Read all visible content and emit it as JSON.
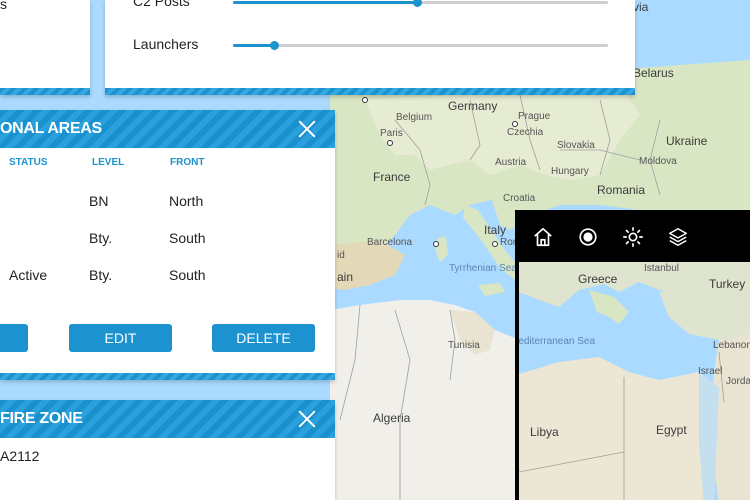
{
  "map": {
    "countries": [
      "Belarus",
      "Germany",
      "Belgium",
      "Czechia",
      "Ukraine",
      "Slovakia",
      "Austria",
      "Hungary",
      "Moldova",
      "France",
      "Romania",
      "Croatia",
      "Italy",
      "Algeria",
      "Tunisia"
    ],
    "cities": [
      "Paris",
      "Prague",
      "Barcelona",
      "Rome"
    ],
    "seas": [
      "Tyrrhenian Sea"
    ],
    "partial_labels": [
      "via",
      "id",
      "ain"
    ]
  },
  "minimap": {
    "labels": [
      "Istanbul",
      "Greece",
      "Turkey",
      "Mediterranean Sea",
      "Lebanon",
      "Israel",
      "Jordan",
      "Libya",
      "Egypt"
    ]
  },
  "sliders_panel": {
    "rows": [
      {
        "label": "C2 Posts",
        "value": 0.49
      },
      {
        "label": "Launchers",
        "value": 0.11
      }
    ]
  },
  "areas_panel": {
    "title": "ONAL AREAS",
    "columns": [
      "STATUS",
      "LEVEL",
      "FRONT"
    ],
    "rows": [
      {
        "status": "",
        "level": "BN",
        "front": "North"
      },
      {
        "status": "",
        "level": "Bty.",
        "front": "South"
      },
      {
        "status": "Active",
        "level": "Bty.",
        "front": "South"
      }
    ],
    "buttons": {
      "edit": "EDIT",
      "delete": "DELETE"
    }
  },
  "fire_panel": {
    "title": "FIRE ZONE",
    "text": "A2112"
  },
  "toolbar": {
    "icons": [
      "home-icon",
      "target-icon",
      "brightness-icon",
      "layers-icon"
    ]
  },
  "colors": {
    "accent": "#1c93cf",
    "land": "#f1efe9",
    "water": "#aadaff"
  }
}
